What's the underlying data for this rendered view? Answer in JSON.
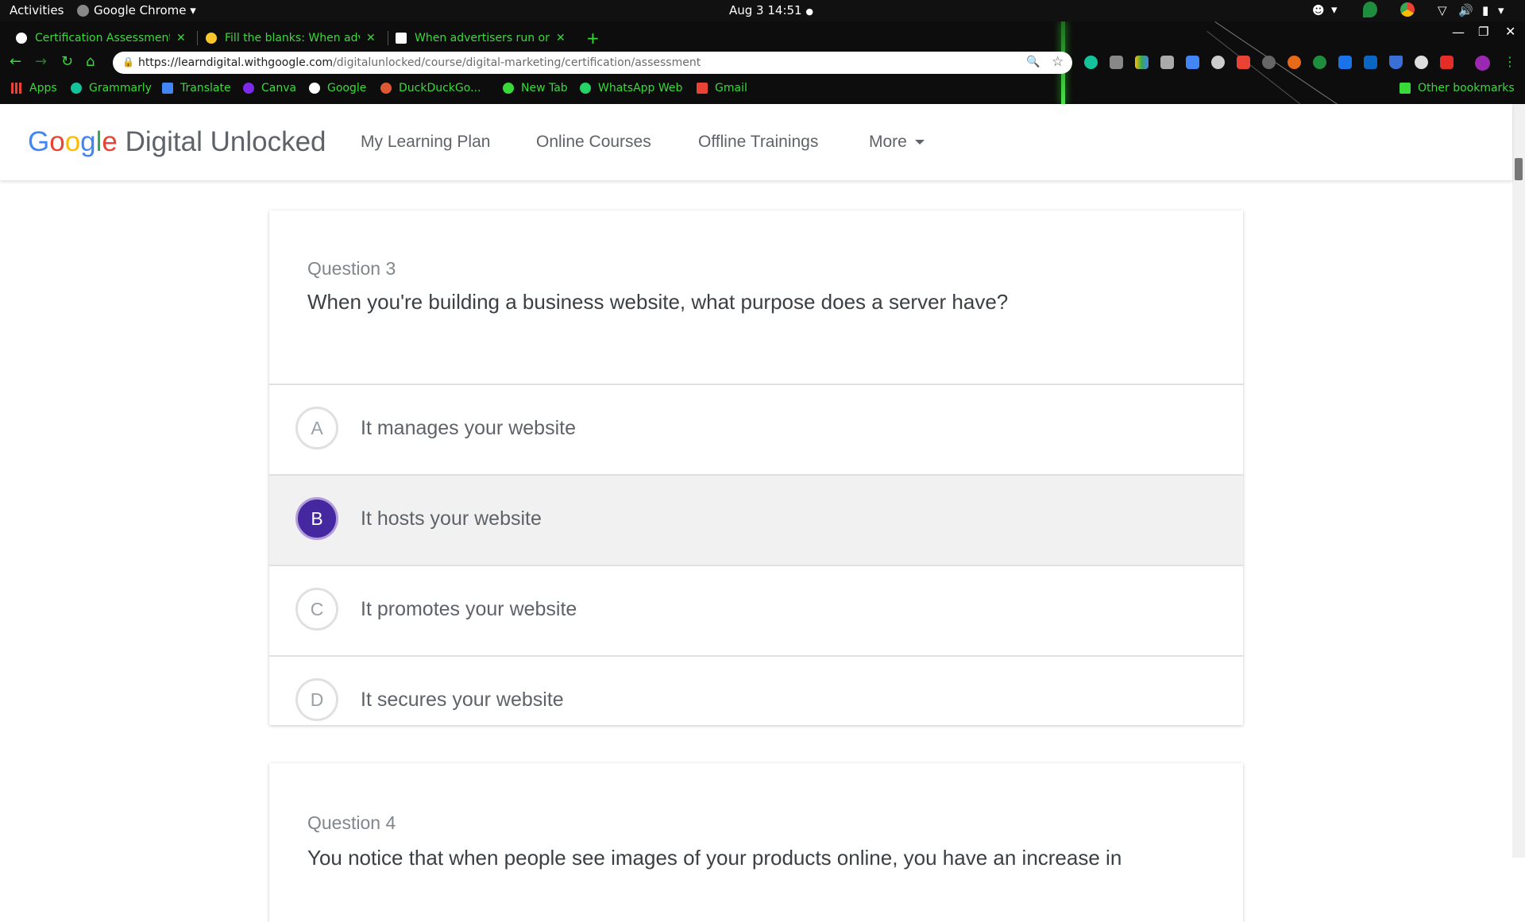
{
  "system_bar": {
    "activities": "Activities",
    "app_name": "Google Chrome",
    "datetime": "Aug 3  14:51"
  },
  "browser": {
    "tabs": [
      {
        "title": "Certification Assessment",
        "icon_color": "#ffffff"
      },
      {
        "title": "Fill the blanks: When adve",
        "icon_color": "#f9c72b"
      },
      {
        "title": "When advertisers run onl",
        "icon_color": "#ffffff"
      }
    ],
    "new_tab_symbol": "+",
    "url_host": "https://learndigital.withgoogle.com",
    "url_path": "/digitalunlocked/course/digital-marketing/certification/assessment",
    "bookmarks": [
      {
        "label": "Apps",
        "color": "#ea4335"
      },
      {
        "label": "Grammarly",
        "color": "#15c39a"
      },
      {
        "label": "Translate",
        "color": "#4285f4"
      },
      {
        "label": "Canva",
        "color": "#7d2ae8"
      },
      {
        "label": "Google",
        "color": "#ffffff"
      },
      {
        "label": "DuckDuckGo...",
        "color": "#de5833"
      },
      {
        "label": "New Tab",
        "color": "#39d93a"
      },
      {
        "label": "WhatsApp Web",
        "color": "#25d366"
      },
      {
        "label": "Gmail",
        "color": "#ea4335"
      }
    ],
    "other_bookmarks": "Other bookmarks",
    "accent_color": "#39d93a"
  },
  "site": {
    "logo_google": "Google",
    "logo_product": " Digital Unlocked",
    "nav": {
      "learning_plan": "My Learning Plan",
      "online_courses": "Online Courses",
      "offline_trainings": "Offline Trainings",
      "more": "More"
    }
  },
  "question3": {
    "number": "Question 3",
    "text": "When you're building a business website, what purpose does a server have?",
    "selected": "B",
    "selected_color": "#4527a0",
    "options": [
      {
        "letter": "A",
        "text": "It manages your website"
      },
      {
        "letter": "B",
        "text": "It hosts your website"
      },
      {
        "letter": "C",
        "text": "It promotes your website"
      },
      {
        "letter": "D",
        "text": "It secures your website"
      }
    ]
  },
  "question4": {
    "number": "Question 4",
    "text_partial": "You notice that when people see images of your products online, you have an increase in"
  }
}
